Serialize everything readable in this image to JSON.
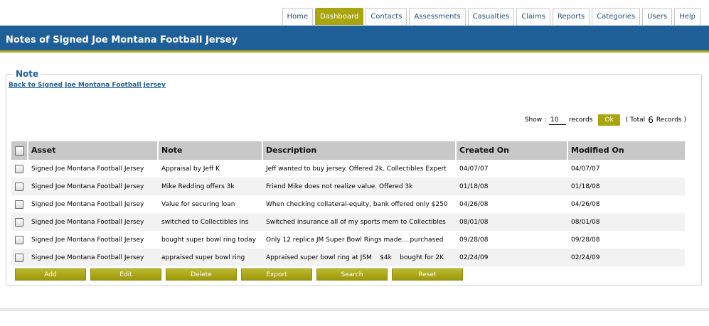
{
  "nav": {
    "tabs": [
      {
        "label": "Home",
        "active": false
      },
      {
        "label": "Dashboard",
        "active": true
      },
      {
        "label": "Contacts",
        "active": false
      },
      {
        "label": "Assessments",
        "active": false
      },
      {
        "label": "Casualties",
        "active": false
      },
      {
        "label": "Claims",
        "active": false
      },
      {
        "label": "Reports",
        "active": false
      },
      {
        "label": "Categories",
        "active": false
      },
      {
        "label": "Users",
        "active": false
      },
      {
        "label": "Help",
        "active": false
      }
    ]
  },
  "header": {
    "title": "Notes of Signed Joe Montana Football Jersey"
  },
  "panel": {
    "legend": "Note",
    "back_link": "Back to Signed Joe Montana Football Jersey"
  },
  "pager": {
    "show_label": "Show :",
    "records_value": "10",
    "records_label": "records",
    "ok_label": "Ok",
    "total_prefix": "( Total",
    "total_count": "6",
    "total_suffix": "Records )"
  },
  "table": {
    "columns": [
      "Asset",
      "Note",
      "Description",
      "Created On",
      "Modified On"
    ],
    "rows": [
      {
        "asset": "Signed Joe Montana Football Jersey",
        "note": "Appraisal by Jeff K",
        "description": "Jeff wanted to buy jersey. Offered 2k. Collectibles Expert",
        "created": "04/07/07",
        "modified": "04/07/07"
      },
      {
        "asset": "Signed Joe Montana Football Jersey",
        "note": "Mike Redding offers 3k",
        "description": "Friend Mike does not realize value. Offered 3k",
        "created": "01/18/08",
        "modified": "01/18/08"
      },
      {
        "asset": "Signed Joe Montana Football Jersey",
        "note": "Value for securing loan",
        "description": "When checking collateral-equity, bank offered only $250",
        "created": "04/26/08",
        "modified": "04/26/08"
      },
      {
        "asset": "Signed Joe Montana Football Jersey",
        "note": "switched to Collectibles Ins",
        "description": "Switched insurance all of my sports mem to Collectibles",
        "created": "08/01/08",
        "modified": "08/01/08"
      },
      {
        "asset": "Signed Joe Montana Football Jersey",
        "note": "bought super bowl ring today",
        "description": "Only 12 replica JM Super Bowl Rings made... purchased",
        "created": "09/28/08",
        "modified": "09/28/08"
      },
      {
        "asset": "Signed Joe Montana Football Jersey",
        "note": "appraised super bowl ring",
        "description": "Appraised super bowl ring at JSM    $4k    bought for 2K",
        "created": "02/24/09",
        "modified": "02/24/09"
      }
    ]
  },
  "actions": [
    "Add",
    "Edit",
    "Delete",
    "Export",
    "Search",
    "Reset"
  ]
}
